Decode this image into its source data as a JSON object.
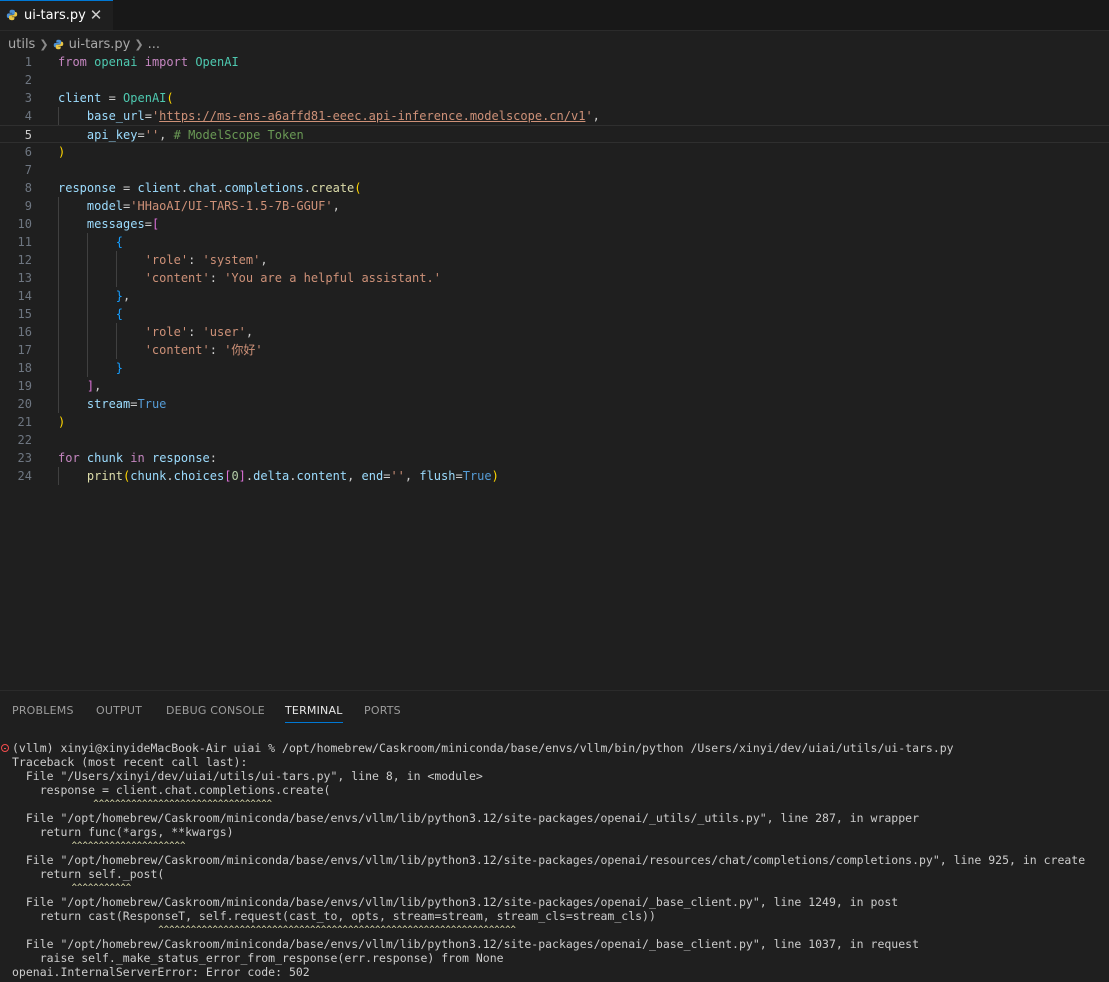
{
  "tab": {
    "label": "ui-tars.py",
    "close": "✕"
  },
  "breadcrumb": {
    "folder": "utils",
    "file": "ui-tars.py",
    "more": "..."
  },
  "editor": {
    "lines": [
      {
        "n": "1",
        "tokens": [
          [
            "k",
            "from"
          ],
          [
            "p",
            " "
          ],
          [
            "t",
            "openai"
          ],
          [
            "p",
            " "
          ],
          [
            "k",
            "import"
          ],
          [
            "p",
            " "
          ],
          [
            "t",
            "OpenAI"
          ]
        ]
      },
      {
        "n": "2",
        "tokens": []
      },
      {
        "n": "3",
        "tokens": [
          [
            "v",
            "client"
          ],
          [
            "p",
            " = "
          ],
          [
            "t",
            "OpenAI"
          ],
          [
            "br1",
            "("
          ]
        ]
      },
      {
        "n": "4",
        "tokens": [
          [
            "p",
            "    "
          ],
          [
            "v",
            "base_url"
          ],
          [
            "p",
            "="
          ],
          [
            "s",
            "'"
          ],
          [
            "s u",
            "https://ms-ens-a6affd81-eeec.api-inference.modelscope.cn/v1"
          ],
          [
            "s",
            "'"
          ],
          [
            "p",
            ","
          ]
        ]
      },
      {
        "n": "5",
        "tokens": [
          [
            "p",
            "    "
          ],
          [
            "v",
            "api_key"
          ],
          [
            "p",
            "="
          ],
          [
            "s",
            "''"
          ],
          [
            "p",
            ", "
          ],
          [
            "c",
            "# ModelScope Token"
          ]
        ]
      },
      {
        "n": "6",
        "tokens": [
          [
            "br1",
            ")"
          ]
        ]
      },
      {
        "n": "7",
        "tokens": []
      },
      {
        "n": "8",
        "tokens": [
          [
            "v",
            "response"
          ],
          [
            "p",
            " = "
          ],
          [
            "v",
            "client"
          ],
          [
            "p",
            "."
          ],
          [
            "v",
            "chat"
          ],
          [
            "p",
            "."
          ],
          [
            "v",
            "completions"
          ],
          [
            "p",
            "."
          ],
          [
            "f",
            "create"
          ],
          [
            "br1",
            "("
          ]
        ]
      },
      {
        "n": "9",
        "tokens": [
          [
            "p",
            "    "
          ],
          [
            "v",
            "model"
          ],
          [
            "p",
            "="
          ],
          [
            "s",
            "'HHaoAI/UI-TARS-1.5-7B-GGUF'"
          ],
          [
            "p",
            ","
          ]
        ]
      },
      {
        "n": "10",
        "tokens": [
          [
            "p",
            "    "
          ],
          [
            "v",
            "messages"
          ],
          [
            "p",
            "="
          ],
          [
            "br2",
            "["
          ]
        ]
      },
      {
        "n": "11",
        "tokens": [
          [
            "p",
            "        "
          ],
          [
            "br3",
            "{"
          ]
        ]
      },
      {
        "n": "12",
        "tokens": [
          [
            "p",
            "            "
          ],
          [
            "s",
            "'role'"
          ],
          [
            "p",
            ": "
          ],
          [
            "s",
            "'system'"
          ],
          [
            "p",
            ","
          ]
        ]
      },
      {
        "n": "13",
        "tokens": [
          [
            "p",
            "            "
          ],
          [
            "s",
            "'content'"
          ],
          [
            "p",
            ": "
          ],
          [
            "s",
            "'You are a helpful assistant.'"
          ]
        ]
      },
      {
        "n": "14",
        "tokens": [
          [
            "p",
            "        "
          ],
          [
            "br3",
            "}"
          ],
          [
            "p",
            ","
          ]
        ]
      },
      {
        "n": "15",
        "tokens": [
          [
            "p",
            "        "
          ],
          [
            "br3",
            "{"
          ]
        ]
      },
      {
        "n": "16",
        "tokens": [
          [
            "p",
            "            "
          ],
          [
            "s",
            "'role'"
          ],
          [
            "p",
            ": "
          ],
          [
            "s",
            "'user'"
          ],
          [
            "p",
            ","
          ]
        ]
      },
      {
        "n": "17",
        "tokens": [
          [
            "p",
            "            "
          ],
          [
            "s",
            "'content'"
          ],
          [
            "p",
            ": "
          ],
          [
            "s",
            "'你好'"
          ]
        ]
      },
      {
        "n": "18",
        "tokens": [
          [
            "p",
            "        "
          ],
          [
            "br3",
            "}"
          ]
        ]
      },
      {
        "n": "19",
        "tokens": [
          [
            "p",
            "    "
          ],
          [
            "br2",
            "]"
          ],
          [
            "p",
            ","
          ]
        ]
      },
      {
        "n": "20",
        "tokens": [
          [
            "p",
            "    "
          ],
          [
            "v",
            "stream"
          ],
          [
            "p",
            "="
          ],
          [
            "b",
            "True"
          ]
        ]
      },
      {
        "n": "21",
        "tokens": [
          [
            "br1",
            ")"
          ]
        ]
      },
      {
        "n": "22",
        "tokens": []
      },
      {
        "n": "23",
        "tokens": [
          [
            "k",
            "for"
          ],
          [
            "p",
            " "
          ],
          [
            "v",
            "chunk"
          ],
          [
            "p",
            " "
          ],
          [
            "k",
            "in"
          ],
          [
            "p",
            " "
          ],
          [
            "v",
            "response"
          ],
          [
            "p",
            ":"
          ]
        ]
      },
      {
        "n": "24",
        "tokens": [
          [
            "p",
            "    "
          ],
          [
            "f",
            "print"
          ],
          [
            "br1",
            "("
          ],
          [
            "v",
            "chunk"
          ],
          [
            "p",
            "."
          ],
          [
            "v",
            "choices"
          ],
          [
            "br2",
            "["
          ],
          [
            "n",
            "0"
          ],
          [
            "br2",
            "]"
          ],
          [
            "p",
            "."
          ],
          [
            "v",
            "delta"
          ],
          [
            "p",
            "."
          ],
          [
            "v",
            "content"
          ],
          [
            "p",
            ", "
          ],
          [
            "v",
            "end"
          ],
          [
            "p",
            "="
          ],
          [
            "s",
            "''"
          ],
          [
            "p",
            ", "
          ],
          [
            "v",
            "flush"
          ],
          [
            "p",
            "="
          ],
          [
            "b",
            "True"
          ],
          [
            "br1",
            ")"
          ]
        ]
      }
    ]
  },
  "panel": {
    "tabs": [
      "PROBLEMS",
      "OUTPUT",
      "DEBUG CONSOLE",
      "TERMINAL",
      "PORTS"
    ],
    "active_tab": "TERMINAL"
  },
  "terminal": {
    "lines": [
      {
        "text": "(vllm) xinyi@xinyideMacBook-Air uiai % /opt/homebrew/Caskroom/miniconda/base/envs/vllm/bin/python /Users/xinyi/dev/uiai/utils/ui-tars.py"
      },
      {
        "text": "Traceback (most recent call last):"
      },
      {
        "text": "  File \"/Users/xinyi/dev/uiai/utils/ui-tars.py\", line 8, in <module>"
      },
      {
        "text": "    response = client.chat.completions.create("
      },
      {
        "text": "               ^^^^^^^^^^^^^^^^^^^^^^^^^^^^^^^^^",
        "caret": true
      },
      {
        "text": "  File \"/opt/homebrew/Caskroom/miniconda/base/envs/vllm/lib/python3.12/site-packages/openai/_utils/_utils.py\", line 287, in wrapper"
      },
      {
        "text": "    return func(*args, **kwargs)"
      },
      {
        "text": "           ^^^^^^^^^^^^^^^^^^^^^",
        "caret": true
      },
      {
        "text": "  File \"/opt/homebrew/Caskroom/miniconda/base/envs/vllm/lib/python3.12/site-packages/openai/resources/chat/completions/completions.py\", line 925, in create"
      },
      {
        "text": "    return self._post("
      },
      {
        "text": "           ^^^^^^^^^^^",
        "caret": true
      },
      {
        "text": "  File \"/opt/homebrew/Caskroom/miniconda/base/envs/vllm/lib/python3.12/site-packages/openai/_base_client.py\", line 1249, in post"
      },
      {
        "text": "    return cast(ResponseT, self.request(cast_to, opts, stream=stream, stream_cls=stream_cls))"
      },
      {
        "text": "                           ^^^^^^^^^^^^^^^^^^^^^^^^^^^^^^^^^^^^^^^^^^^^^^^^^^^^^^^^^^^^^^^^^^",
        "caret": true
      },
      {
        "text": "  File \"/opt/homebrew/Caskroom/miniconda/base/envs/vllm/lib/python3.12/site-packages/openai/_base_client.py\", line 1037, in request"
      },
      {
        "text": "    raise self._make_status_error_from_response(err.response) from None"
      },
      {
        "text": "openai.InternalServerError: Error code: 502"
      }
    ]
  },
  "colors": {
    "accent": "#0078d4",
    "editor_bg": "#1f1f1f",
    "error": "#f14c4c"
  },
  "icons": {
    "python_file": "python-file-icon",
    "close": "close-icon",
    "chevron": "chevron-right-icon",
    "error": "error-circle-icon"
  }
}
